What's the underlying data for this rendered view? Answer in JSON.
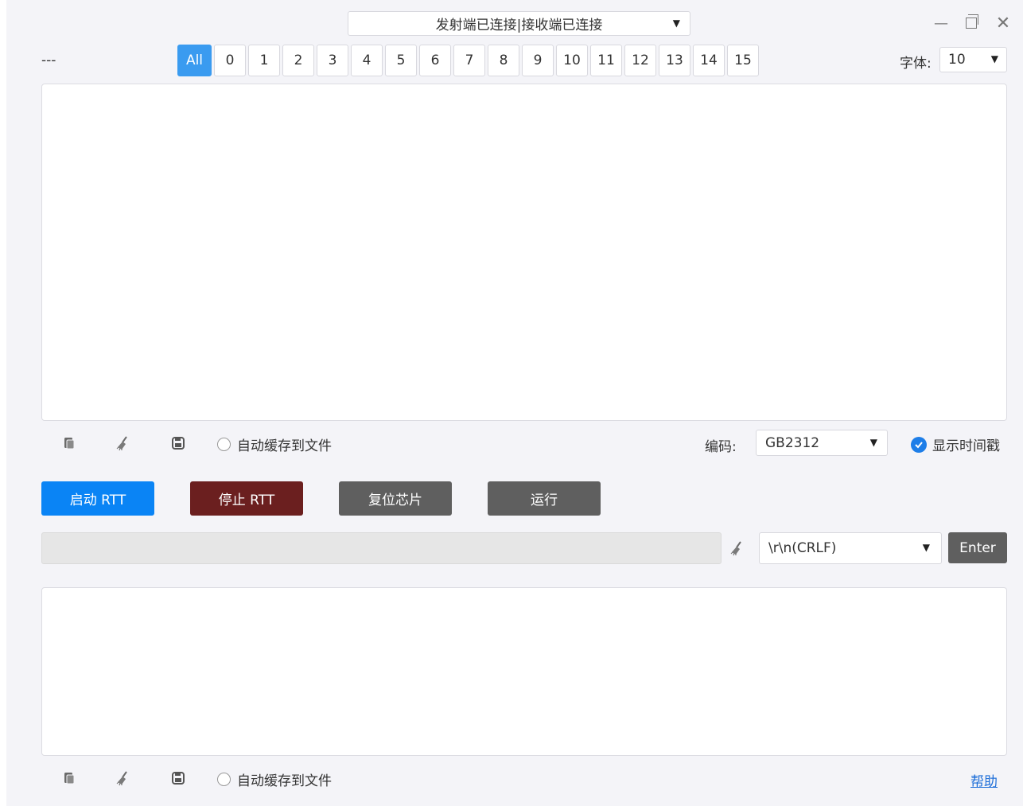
{
  "header": {
    "connection_status": "发射端已连接|接收端已连接",
    "left_placeholder": "---",
    "window_controls": {
      "minimize": "—",
      "close": "✕"
    }
  },
  "channels": [
    "All",
    "0",
    "1",
    "2",
    "3",
    "4",
    "5",
    "6",
    "7",
    "8",
    "9",
    "10",
    "11",
    "12",
    "13",
    "14",
    "15"
  ],
  "active_channel": "All",
  "font": {
    "label": "字体:",
    "value": "10"
  },
  "output_toolbar": {
    "icons": [
      "copy-icon",
      "clear-broom-icon",
      "save-icon"
    ],
    "auto_save_label": "自动缓存到文件",
    "encoding_label": "编码:",
    "encoding_value": "GB2312",
    "show_timestamp_label": "显示时间戳",
    "show_timestamp_checked": true
  },
  "actions": {
    "start": "启动 RTT",
    "stop": "停止 RTT",
    "reset": "复位芯片",
    "run": "运行"
  },
  "send": {
    "input_value": "",
    "line_ending": "\\r\\n(CRLF)",
    "enter_label": "Enter"
  },
  "input_toolbar": {
    "auto_save_label": "自动缓存到文件",
    "help_link": "帮助"
  },
  "colors": {
    "accent": "#0a84f5",
    "channel_active": "#3a9bf0",
    "stop_button": "#6b1f1f",
    "gray_button": "#5f5f5f",
    "link": "#1e6ed8"
  }
}
